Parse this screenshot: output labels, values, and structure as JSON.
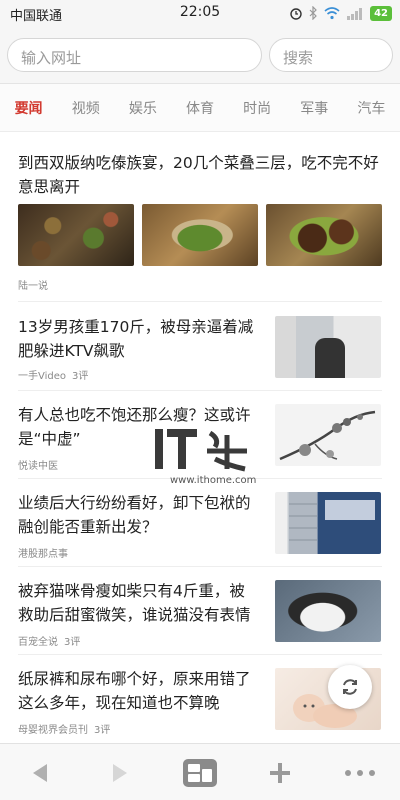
{
  "status_bar": {
    "carrier": "中国联通",
    "time": "22:05",
    "battery": "42",
    "icons": [
      "alarm-icon",
      "bluetooth-icon",
      "wifi-icon",
      "signal-icon",
      "battery-icon"
    ]
  },
  "address_bar": {
    "url_placeholder": "输入网址",
    "search_placeholder": "搜索"
  },
  "tabs": [
    {
      "label": "要闻",
      "active": true
    },
    {
      "label": "视频",
      "active": false
    },
    {
      "label": "娱乐",
      "active": false
    },
    {
      "label": "体育",
      "active": false
    },
    {
      "label": "时尚",
      "active": false
    },
    {
      "label": "军事",
      "active": false
    },
    {
      "label": "汽车",
      "active": false
    }
  ],
  "feed": [
    {
      "title": "到西双版纳吃傣族宴，20几个菜叠三层，吃不完不好意思离开",
      "source": "陆一说",
      "comments": ""
    },
    {
      "title": "13岁男孩重170斤，被母亲逼着减肥躲进KTV飙歌",
      "source": "一手Video",
      "comments": "3评"
    },
    {
      "title": "有人总也吃不饱还那么瘦？这或许是“中虚”",
      "source": "悦读中医",
      "comments": ""
    },
    {
      "title": "业绩后大行纷纷看好，卸下包袱的融创能否重新出发？",
      "source": "港股那点事",
      "comments": ""
    },
    {
      "title": "被弃猫咪骨瘦如柴只有4斤重，被救助后甜蜜微笑，谁说猫没有表情",
      "source": "百宠全说",
      "comments": "3评"
    },
    {
      "title": "纸尿裤和尿布哪个好，原来用错了这么多年，现在知道也不算晚",
      "source": "母婴视界会员刊",
      "comments": "3评"
    }
  ],
  "watermark": {
    "brand": "IT之家",
    "url": "www.ithome.com"
  },
  "colors": {
    "accent": "#d23a30",
    "battery": "#5bbf3a"
  }
}
